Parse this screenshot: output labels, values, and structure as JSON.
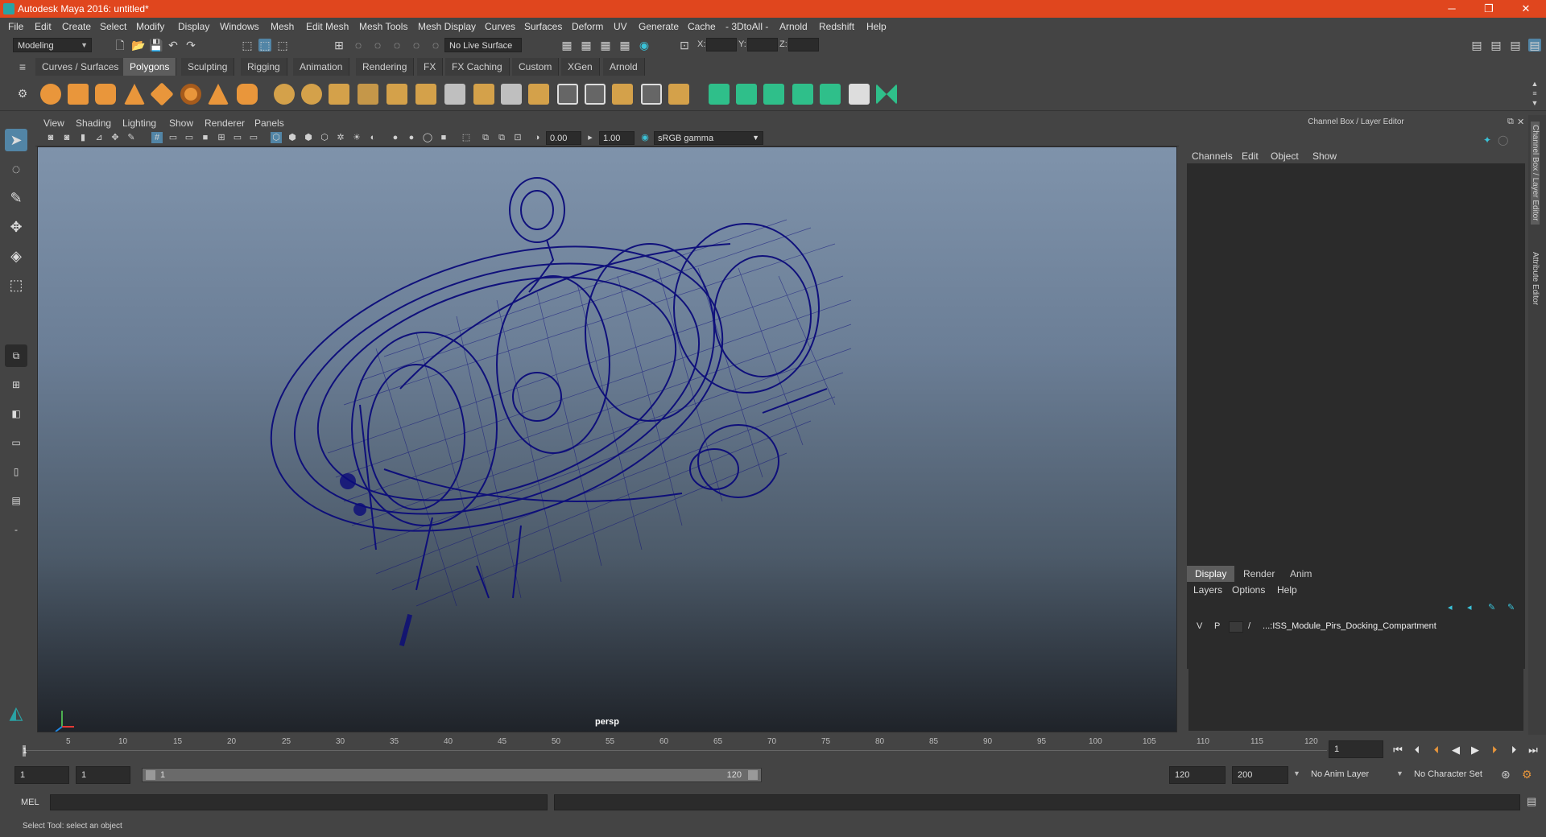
{
  "title_bar": {
    "title": "Autodesk Maya 2016: untitled*",
    "minimize": "─",
    "restore": "❐",
    "close": "✕"
  },
  "menus": [
    "File",
    "Edit",
    "Create",
    "Select",
    "Modify",
    "Display",
    "Windows",
    "Mesh",
    "Edit Mesh",
    "Mesh Tools",
    "Mesh Display",
    "Curves",
    "Surfaces",
    "Deform",
    "UV",
    "Generate",
    "Cache",
    "- 3DtoAll -",
    "Arnold",
    "Redshift",
    "Help"
  ],
  "status_line": {
    "menuset": "Modeling",
    "live_surface": "No Live Surface",
    "x_label": "X:",
    "y_label": "Y:",
    "z_label": "Z:"
  },
  "shelf_tabs": [
    "Curves / Surfaces",
    "Polygons",
    "Sculpting",
    "Rigging",
    "Animation",
    "Rendering",
    "FX",
    "FX Caching",
    "Custom",
    "XGen",
    "Arnold"
  ],
  "shelf_active": "Polygons",
  "shelf_colors": {
    "primitive": "#e9963b",
    "tool": "#d4a14a",
    "green": "#2fbf8a"
  },
  "viewport": {
    "menus": [
      "View",
      "Shading",
      "Lighting",
      "Show",
      "Renderer",
      "Panels"
    ],
    "exposure": "0.00",
    "gamma": "1.00",
    "color_space": "sRGB gamma",
    "camera_label": "persp",
    "wire_color": "#0b0b7a"
  },
  "channel_box": {
    "title": "Channel Box / Layer Editor",
    "menus": [
      "Channels",
      "Edit",
      "Object",
      "Show"
    ],
    "side_tab_1": "Channel Box / Layer Editor",
    "side_tab_2": "Attribute Editor"
  },
  "layer_editor": {
    "tabs": [
      "Display",
      "Render",
      "Anim"
    ],
    "active_tab": "Display",
    "menus": [
      "Layers",
      "Options",
      "Help"
    ],
    "layers": [
      {
        "v": "V",
        "p": "P",
        "name": "...:ISS_Module_Pirs_Docking_Compartment"
      }
    ]
  },
  "time_slider": {
    "ticks": [
      "1",
      "5",
      "10",
      "15",
      "20",
      "25",
      "30",
      "35",
      "40",
      "45",
      "50",
      "55",
      "60",
      "65",
      "70",
      "75",
      "80",
      "85",
      "90",
      "95",
      "100",
      "105",
      "110",
      "115",
      "120"
    ],
    "current_frame": "1"
  },
  "range": {
    "start": "1",
    "playback_start": "1",
    "slider_start": "1",
    "slider_end": "120",
    "playback_end": "120",
    "end": "200",
    "anim_layer": "No Anim Layer",
    "char_set": "No Character Set"
  },
  "mel": {
    "label": "MEL"
  },
  "help_line": "Select Tool: select an object"
}
